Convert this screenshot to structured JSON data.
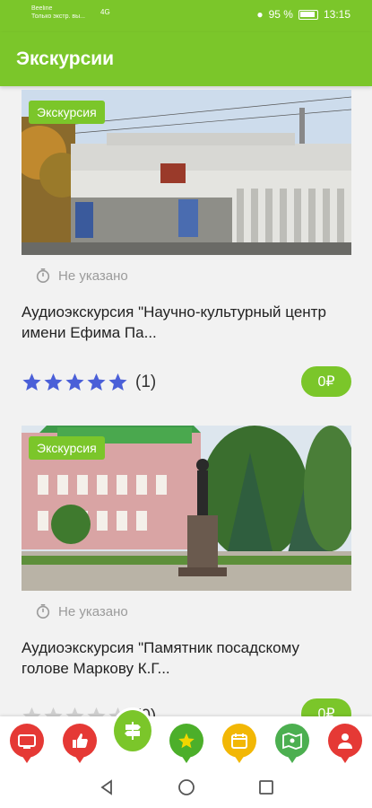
{
  "status": {
    "carrier": "Beeline",
    "carrier_sub": "Только экстр. вы...",
    "network": "4G",
    "battery": "95 %",
    "time": "13:15"
  },
  "header": {
    "title": "Экскурсии"
  },
  "tours": [
    {
      "tag": "Экскурсия",
      "duration": "Не указано",
      "title": "Аудиоэкскурсия \"Научно-культурный центр имени Ефима Па...",
      "rating": 5,
      "rating_count": "(1)",
      "price": "0₽"
    },
    {
      "tag": "Экскурсия",
      "duration": "Не указано",
      "title": "Аудиоэкскурсия \"Памятник посадскому голове Маркову К.Г...",
      "rating": 0,
      "rating_count": "(0)",
      "price": "0₽"
    }
  ],
  "bottom_nav": [
    {
      "name": "tv-icon",
      "color": "#e53935"
    },
    {
      "name": "thumb-up-icon",
      "color": "#e53935"
    },
    {
      "name": "signpost-icon",
      "color": "#7bc62a"
    },
    {
      "name": "star-icon",
      "color": "#4caf2a"
    },
    {
      "name": "calendar-icon",
      "color": "#f2b705"
    },
    {
      "name": "map-icon",
      "color": "#4caf50"
    },
    {
      "name": "user-icon",
      "color": "#e53935"
    }
  ],
  "colors": {
    "accent": "#7bc62a",
    "star": "#4a5fd8"
  }
}
